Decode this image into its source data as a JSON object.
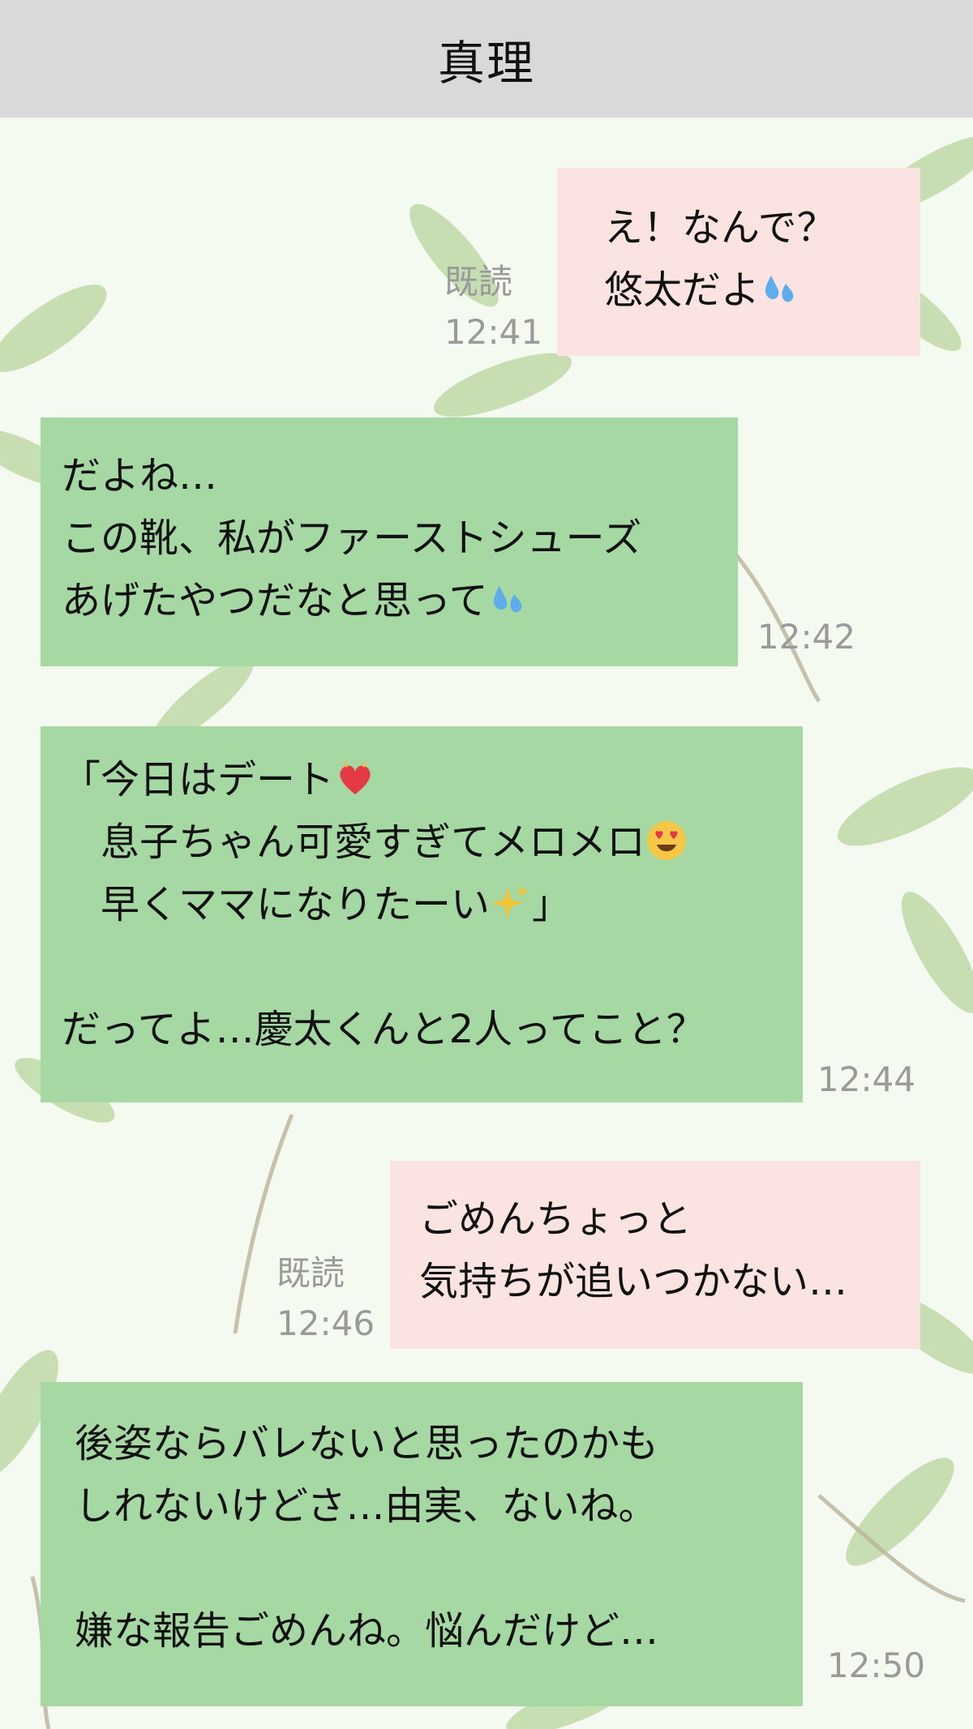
{
  "header": {
    "title": "真理"
  },
  "messages": [
    {
      "id": "m1",
      "direction": "outgoing",
      "lines": [
        "え！なんで？",
        "悠太だよ"
      ],
      "emoji": "sweat-droplets-icon",
      "read_label": "既読",
      "time": "12:41"
    },
    {
      "id": "m2",
      "direction": "incoming",
      "lines": [
        "だよね…",
        "この靴、私がファーストシューズ",
        "あげたやつだなと思って"
      ],
      "emoji": "sweat-droplets-icon",
      "time": "12:42"
    },
    {
      "id": "m3",
      "direction": "incoming",
      "lines": [
        "「今日はデート",
        "　息子ちゃん可愛すぎてメロメロ",
        "　早くママになりたーい",
        "」",
        "だってよ…慶太くんと2人ってこと？"
      ],
      "emojis": [
        "heart-icon",
        "heart-eyes-icon",
        "sparkles-icon"
      ],
      "time": "12:44"
    },
    {
      "id": "m4",
      "direction": "outgoing",
      "lines": [
        "ごめんちょっと",
        "気持ちが追いつかない…"
      ],
      "read_label": "既読",
      "time": "12:46"
    },
    {
      "id": "m5",
      "direction": "incoming",
      "lines": [
        "後姿ならバレないと思ったのかも",
        "しれないけどさ…由実、ないね。",
        "嫌な報告ごめんね。悩んだけど…"
      ],
      "time": "12:50"
    }
  ],
  "colors": {
    "header_bg": "#d9d9d9",
    "outgoing_bubble": "#fbe3e1",
    "incoming_bubble": "#a5d8a2",
    "meta_text": "#9a9a9a",
    "background": "#f4faef"
  }
}
